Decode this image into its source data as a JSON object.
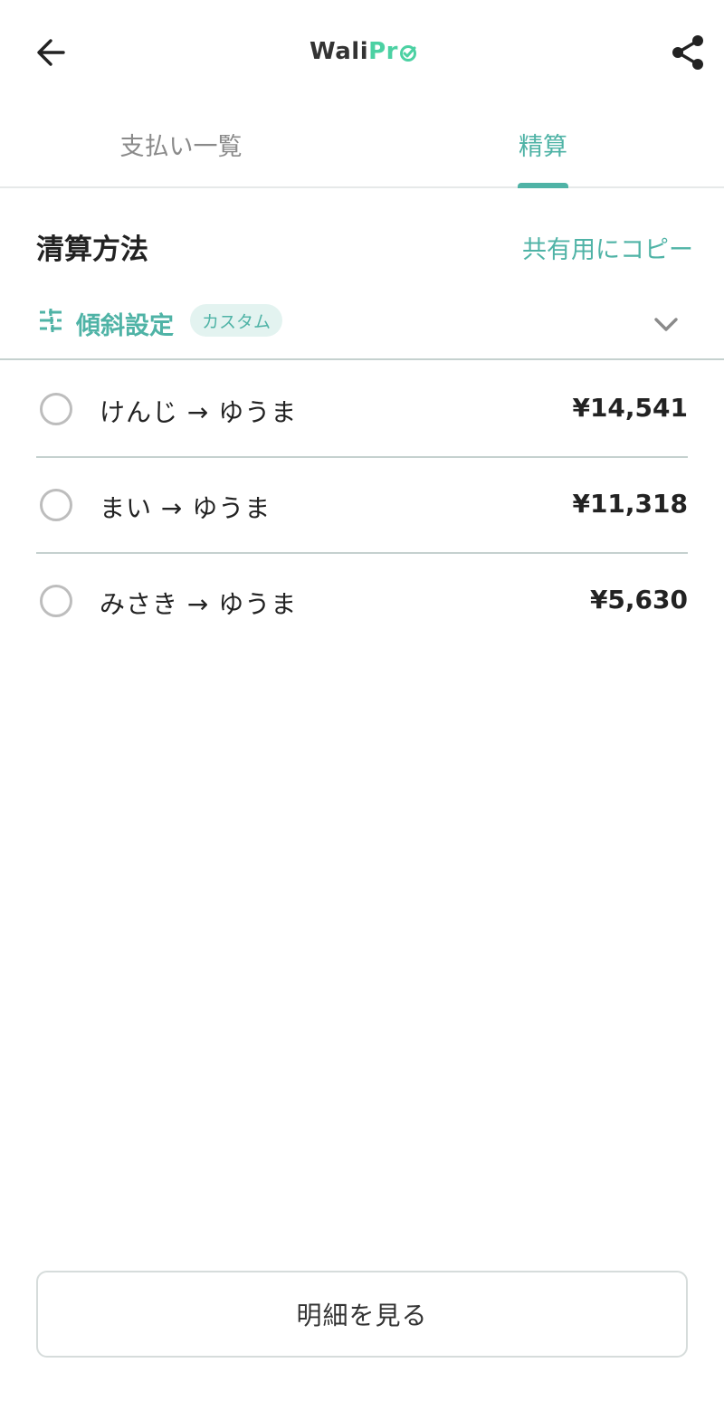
{
  "header": {
    "logo_part1": "Wali",
    "logo_part2": "Pr",
    "back_icon": "arrow-left-icon",
    "share_icon": "share-icon"
  },
  "tabs": [
    {
      "label": "支払い一覧",
      "active": false
    },
    {
      "label": "精算",
      "active": true
    }
  ],
  "settlement": {
    "title": "清算方法",
    "copy_label": "共有用にコピー",
    "tilt": {
      "label": "傾斜設定",
      "badge": "カスタム",
      "icon": "sliders-icon",
      "expand_icon": "chevron-down-icon"
    },
    "items": [
      {
        "label": "けんじ → ゆうま",
        "amount": "¥14,541",
        "checked": false
      },
      {
        "label": "まい → ゆうま",
        "amount": "¥11,318",
        "checked": false
      },
      {
        "label": "みさき → ゆうま",
        "amount": "¥5,630",
        "checked": false
      }
    ]
  },
  "footer": {
    "detail_button": "明細を見る"
  },
  "colors": {
    "accent": "#4fb3a6",
    "logo_accent": "#4cd1a3",
    "text": "#222222",
    "muted": "#8a8a8a",
    "divider": "#c5d1cf"
  }
}
